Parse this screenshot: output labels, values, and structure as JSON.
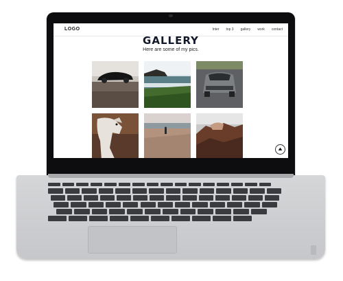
{
  "navbar": {
    "logo": "LOGO",
    "links": [
      "Inter",
      "top 3",
      "gallery",
      "work",
      "contact"
    ]
  },
  "page": {
    "title": "GALLERY",
    "subtitle": "Here are some of my pics."
  },
  "gallery": {
    "images": [
      {
        "subject": "black sports car on gravel road"
      },
      {
        "subject": "rocky coast with grass and ocean"
      },
      {
        "subject": "grey car on road"
      },
      {
        "subject": "white dog"
      },
      {
        "subject": "person walking on beach"
      },
      {
        "subject": "dog lying on rocks"
      }
    ]
  },
  "scroll_top_icon": "arrow-up-icon",
  "colors": {
    "title": "#111827",
    "lid": "#0d0d0f",
    "chassis": "#d5d6d8"
  }
}
